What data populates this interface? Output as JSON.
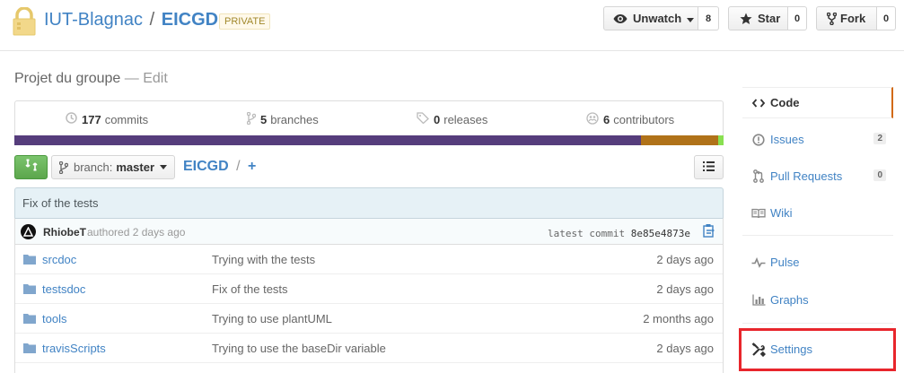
{
  "repo": {
    "owner": "IUT-Blagnac",
    "separator": "/",
    "name": "EICGD",
    "visibility": "PRIVATE",
    "description": "Projet du groupe",
    "description_edit": "Edit"
  },
  "actions": {
    "watch_label": "Unwatch",
    "watch_count": "8",
    "star_label": "Star",
    "star_count": "0",
    "fork_label": "Fork",
    "fork_count": "0"
  },
  "summary": {
    "commits_count": "177",
    "commits_label": "commits",
    "branches_count": "5",
    "branches_label": "branches",
    "releases_count": "0",
    "releases_label": "releases",
    "contributors_count": "6",
    "contributors_label": "contributors"
  },
  "languages": [
    {
      "color": "#563d7c",
      "share": 0.883
    },
    {
      "color": "#b07219",
      "share": 0.11
    },
    {
      "color": "#89e051",
      "share": 0.007
    }
  ],
  "branch": {
    "label": "branch:",
    "name": "master"
  },
  "breadcrumb": {
    "root": "EICGD",
    "sep": "/",
    "add": "+"
  },
  "commit": {
    "message": "Fix of the tests",
    "author": "RhiobeT",
    "authored": "authored 2 days ago",
    "latest_label": "latest commit",
    "sha": "8e85e4873e"
  },
  "files": [
    {
      "name": "srcdoc",
      "message": "Trying with the tests",
      "age": "2 days ago"
    },
    {
      "name": "testsdoc",
      "message": "Fix of the tests",
      "age": "2 days ago"
    },
    {
      "name": "tools",
      "message": "Trying to use plantUML",
      "age": "2 months ago"
    },
    {
      "name": "travisScripts",
      "message": "Trying to use the baseDir variable",
      "age": "2 days ago"
    }
  ],
  "sidebar": {
    "code": "Code",
    "issues": "Issues",
    "issues_count": "2",
    "pulls": "Pull Requests",
    "pulls_count": "0",
    "wiki": "Wiki",
    "pulse": "Pulse",
    "graphs": "Graphs",
    "settings": "Settings"
  },
  "colors": {
    "link": "#4183c4",
    "accent": "#d26911",
    "highlight": "#e8262c"
  }
}
